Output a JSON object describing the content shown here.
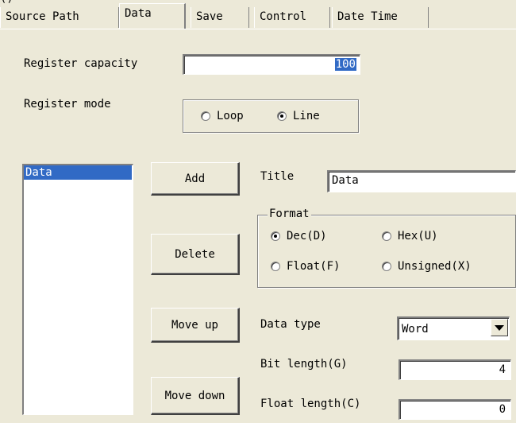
{
  "top_fragment": "()",
  "tabs": [
    {
      "label": "Source Path"
    },
    {
      "label": "Data"
    },
    {
      "label": "Save"
    },
    {
      "label": "Control"
    },
    {
      "label": "Date Time"
    }
  ],
  "register": {
    "capacity_label": "Register capacity",
    "capacity_value": "100",
    "mode_label": "Register mode",
    "mode_options": {
      "loop": "Loop",
      "line": "Line"
    },
    "mode_selected": "Line"
  },
  "list": {
    "items": [
      "Data"
    ],
    "selected": "Data"
  },
  "buttons": {
    "add": "Add",
    "delete": "Delete",
    "move_up": "Move up",
    "move_down": "Move down"
  },
  "title": {
    "label": "Title",
    "value": "Data"
  },
  "format": {
    "legend": "Format",
    "options": {
      "dec": "Dec(D)",
      "hex": "Hex(U)",
      "float": "Float(F)",
      "unsigned": "Unsigned(X)"
    },
    "selected": "Dec(D)"
  },
  "data_type": {
    "label": "Data type",
    "value": "Word"
  },
  "bit_length": {
    "label": "Bit length(G)",
    "value": "4"
  },
  "float_length": {
    "label": "Float length(C)",
    "value": "0"
  }
}
